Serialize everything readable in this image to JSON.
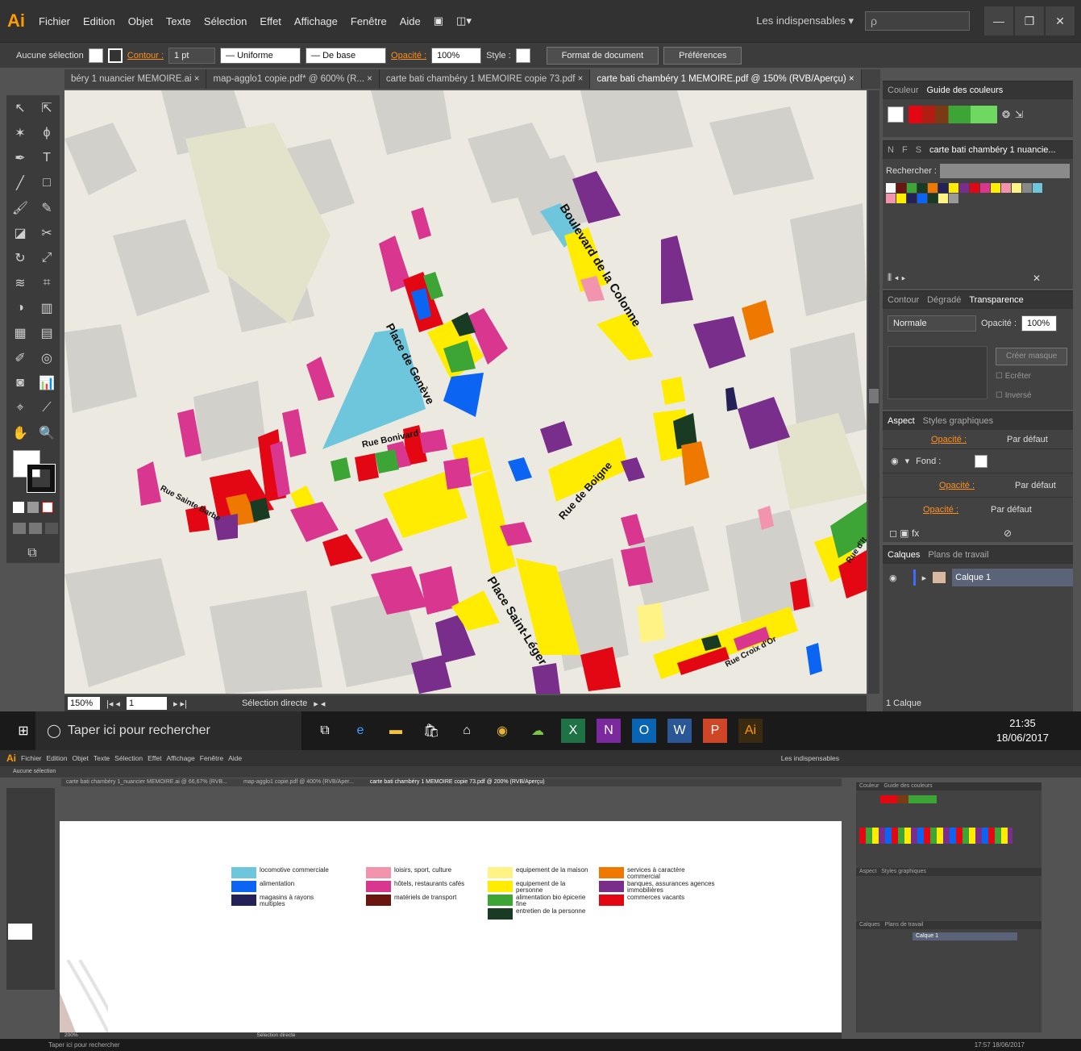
{
  "app": {
    "logo": "Ai",
    "menu": [
      "Fichier",
      "Edition",
      "Objet",
      "Texte",
      "Sélection",
      "Effet",
      "Affichage",
      "Fenêtre",
      "Aide"
    ],
    "workspace": "Les indispensables",
    "search_placeholder": "ρ"
  },
  "control_bar": {
    "selection": "Aucune sélection",
    "contour_label": "Contour :",
    "stroke_weight": "1 pt",
    "profile": "Uniforme",
    "brush": "De base",
    "opacity_label": "Opacité :",
    "opacity_value": "100%",
    "style_label": "Style :",
    "doc_format_button": "Format de document",
    "prefs_button": "Préférences"
  },
  "tabs": [
    {
      "label": "béry 1 nuancier MEMOIRE.ai",
      "active": false
    },
    {
      "label": "map-agglo1 copie.pdf* @ 600% (R...",
      "active": false
    },
    {
      "label": "carte bati chambéry 1 MEMOIRE copie 73.pdf",
      "active": false
    },
    {
      "label": "carte bati chambéry 1 MEMOIRE.pdf @ 150% (RVB/Aperçu)",
      "active": true
    }
  ],
  "map": {
    "streets": [
      {
        "name": "Boulevard de la Colonne"
      },
      {
        "name": "Place de Genève"
      },
      {
        "name": "Rue Bonivard"
      },
      {
        "name": "Rue Sainte Barbe"
      },
      {
        "name": "Rue de Boigne"
      },
      {
        "name": "Place Saint-Léger"
      },
      {
        "name": "Rue Croix d'Or"
      },
      {
        "name": "Rue d'It"
      }
    ]
  },
  "status": {
    "zoom": "150%",
    "page": "1",
    "tool": "Sélection directe"
  },
  "panels": {
    "color": {
      "tabs": [
        "Couleur",
        "Guide des couleurs"
      ]
    },
    "swatches": {
      "tabs": [
        "N",
        "F",
        "S",
        "carte bati chambéry 1 nuancie..."
      ],
      "search_label": "Rechercher :"
    },
    "transparency": {
      "tabs": [
        "Contour",
        "Dégradé",
        "Transparence"
      ],
      "mode": "Normale",
      "opacity_label": "Opacité :",
      "opacity_value": "100%",
      "mask_button": "Créer masque",
      "clip_label": "Ecrêter",
      "invert_label": "Inversé"
    },
    "aspect": {
      "tabs": [
        "Aspect",
        "Styles graphiques"
      ],
      "rows": [
        {
          "label": "Opacité :",
          "value": "Par défaut"
        },
        {
          "label": "Fond :",
          "value": ""
        },
        {
          "label": "Opacité :",
          "value": "Par défaut"
        },
        {
          "label": "Opacité :",
          "value": "Par défaut"
        }
      ]
    },
    "layers": {
      "tabs": [
        "Calques",
        "Plans de travail"
      ],
      "layer_name": "Calque 1",
      "footer": "1 Calque"
    }
  },
  "taskbar": {
    "search": "Taper ici pour rechercher",
    "time": "21:35",
    "date": "18/06/2017"
  },
  "screen2": {
    "tabs": [
      "carte bati chambéry 1_nuancier MEMOIRE.ai @ 66,67% (RVB...",
      "map-agglo1 copie.pdf @ 400% (RVB/Aper...",
      "carte bati chambéry 1 MEMOIRE copie 73.pdf @ 200% (RVB/Aperçu)"
    ],
    "zoom": "200%",
    "tool": "Sélection directe",
    "time": "17:57",
    "date": "18/06/2017",
    "legend": [
      {
        "label": "locomotive commerciale",
        "color": "#6ec6dc"
      },
      {
        "label": "alimentation",
        "color": "#0b64f2"
      },
      {
        "label": "magasins à rayons multiples",
        "color": "#232158"
      },
      {
        "label": "loisirs, sport, culture",
        "color": "#f294ae"
      },
      {
        "label": "hôtels, restaurants cafés",
        "color": "#d9368f"
      },
      {
        "label": "matériels de transport",
        "color": "#6b1511"
      },
      {
        "label": "equipement de la maison",
        "color": "#fff386"
      },
      {
        "label": "equipement de la personne",
        "color": "#ffec00"
      },
      {
        "label": "alimentation bio épicerie fine",
        "color": "#3da535"
      },
      {
        "label": "entretien de la personne",
        "color": "#193b23"
      },
      {
        "label": "services à caractère commercial",
        "color": "#ef7800"
      },
      {
        "label": "banques, assurances agences immobilières",
        "color": "#7a2e8b"
      },
      {
        "label": "commerces vacants",
        "color": "#e30613"
      }
    ]
  }
}
